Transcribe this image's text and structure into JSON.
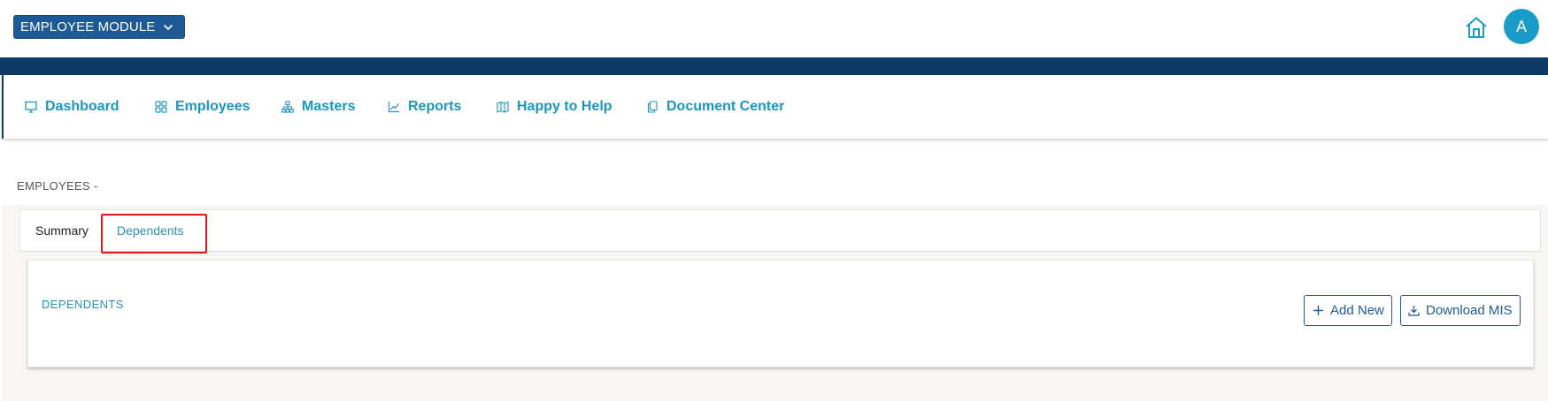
{
  "header": {
    "module_selector": "EMPLOYEE MODULE",
    "avatar_initial": "A"
  },
  "nav": {
    "items": [
      {
        "label": "Dashboard",
        "icon": "monitor-icon"
      },
      {
        "label": "Employees",
        "icon": "grid-icon"
      },
      {
        "label": "Masters",
        "icon": "hierarchy-icon"
      },
      {
        "label": "Reports",
        "icon": "line-chart-icon"
      },
      {
        "label": "Happy to Help",
        "icon": "map-icon"
      },
      {
        "label": "Document Center",
        "icon": "documents-icon"
      }
    ]
  },
  "page": {
    "breadcrumb": "EMPLOYEES -",
    "tabs": [
      {
        "label": "Summary",
        "active": false
      },
      {
        "label": "Dependents",
        "active": true
      }
    ],
    "section_title": "DEPENDENTS",
    "buttons": {
      "add_new": "Add New",
      "download_mis": "Download MIS"
    }
  },
  "colors": {
    "brand_navy": "#0d3a66",
    "module_blue": "#1f5a96",
    "accent_cyan": "#1b97bf",
    "highlight_red": "#e4181b"
  }
}
